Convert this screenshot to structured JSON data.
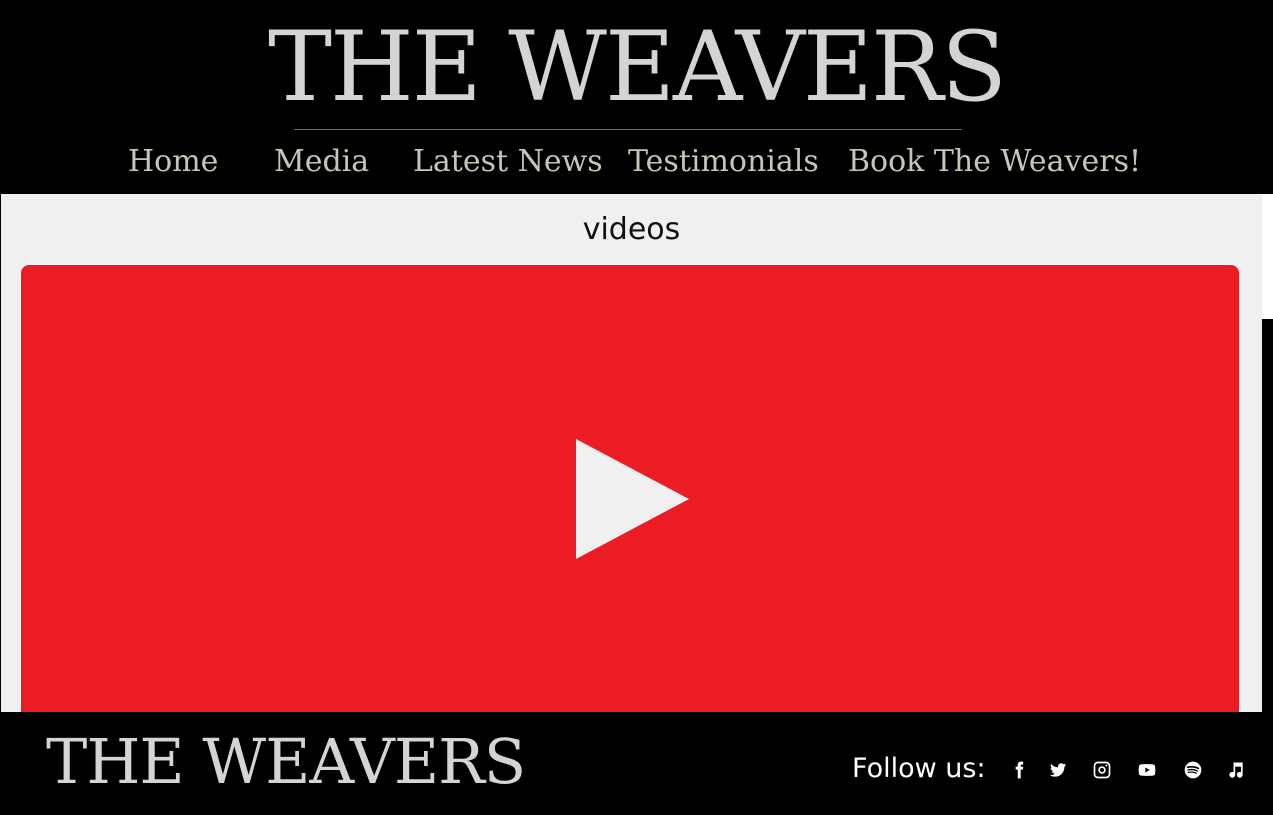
{
  "brand": {
    "title": "THE WEAVERS"
  },
  "nav": {
    "items": [
      "Home",
      "Media",
      "Latest News",
      "Testimonials",
      "Book The Weavers!"
    ]
  },
  "main": {
    "section_title": "videos",
    "video": {
      "platform": "youtube",
      "play_icon": "play-icon"
    }
  },
  "footer": {
    "logo": "THE WEAVERS",
    "follow_label": "Follow us:",
    "social_icons": [
      "facebook-icon",
      "twitter-icon",
      "instagram-icon",
      "youtube-icon",
      "spotify-icon",
      "music-note-icon"
    ]
  },
  "colors": {
    "background": "#000000",
    "accent": "#ec1c24",
    "content_bg": "#f0f0f0",
    "nav_text": "#c8c5b8"
  }
}
